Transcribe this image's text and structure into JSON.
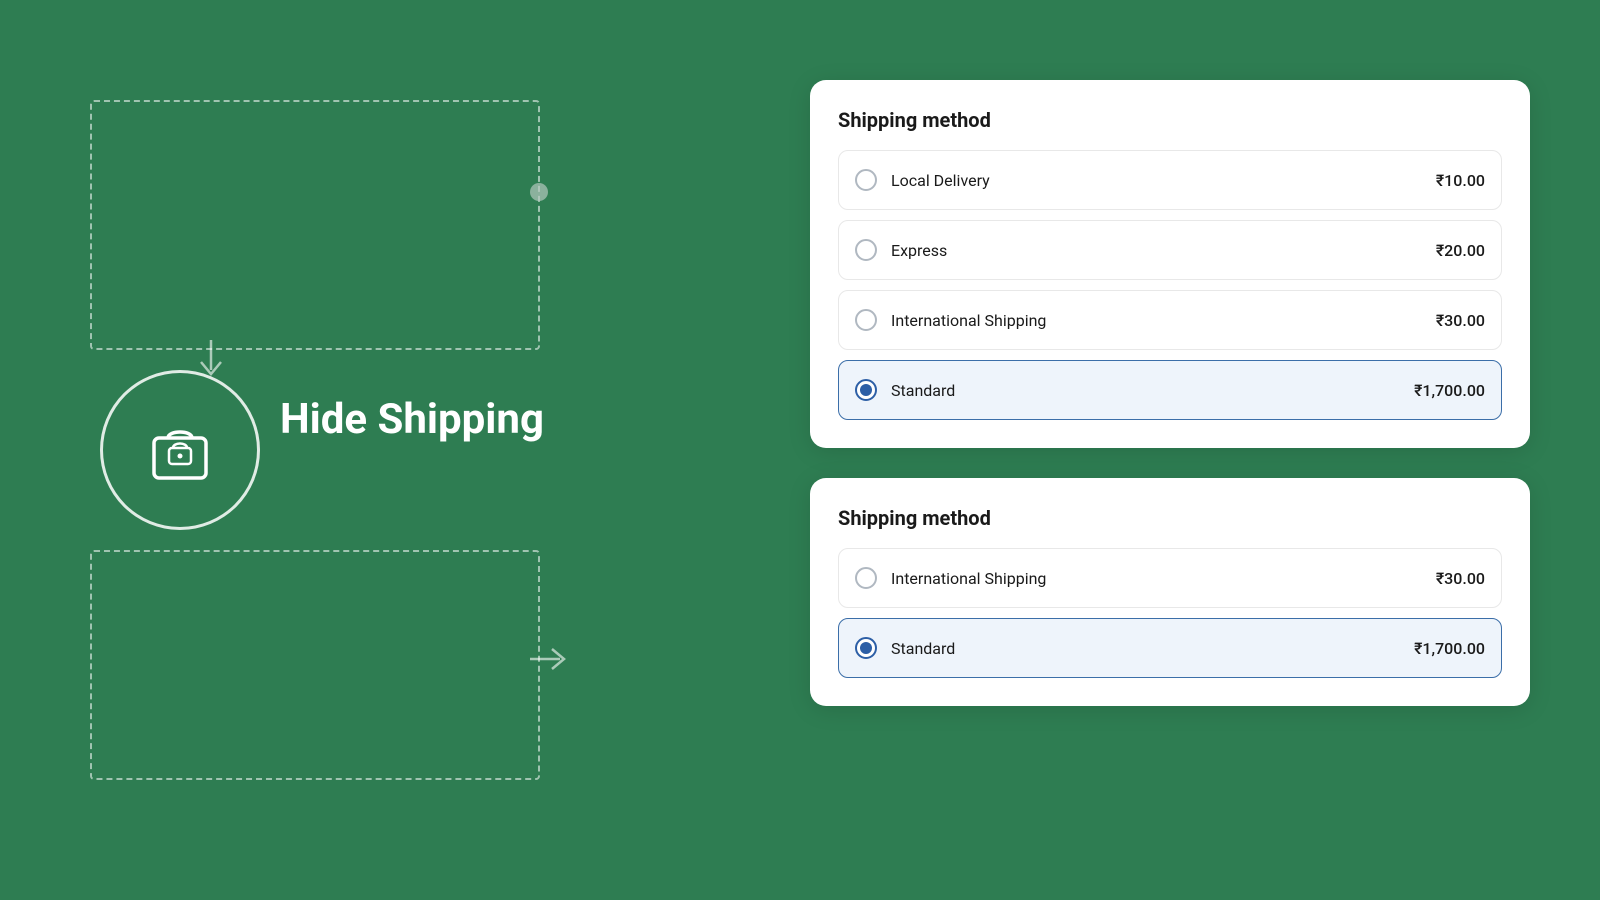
{
  "background_color": "#2e7d52",
  "left": {
    "logo_alt": "Hide Shipping logo",
    "title": "Hide Shipping"
  },
  "cards": [
    {
      "id": "card-top",
      "title": "Shipping method",
      "options": [
        {
          "id": "opt-local",
          "name": "Local Delivery",
          "price": "₹10.00",
          "selected": false
        },
        {
          "id": "opt-express",
          "name": "Express",
          "price": "₹20.00",
          "selected": false
        },
        {
          "id": "opt-intl",
          "name": "International Shipping",
          "price": "₹30.00",
          "selected": false
        },
        {
          "id": "opt-standard",
          "name": "Standard",
          "price": "₹1,700.00",
          "selected": true
        }
      ]
    },
    {
      "id": "card-bottom",
      "title": "Shipping method",
      "options": [
        {
          "id": "opt-intl2",
          "name": "International Shipping",
          "price": "₹30.00",
          "selected": false
        },
        {
          "id": "opt-standard2",
          "name": "Standard",
          "price": "₹1,700.00",
          "selected": true
        }
      ]
    }
  ]
}
